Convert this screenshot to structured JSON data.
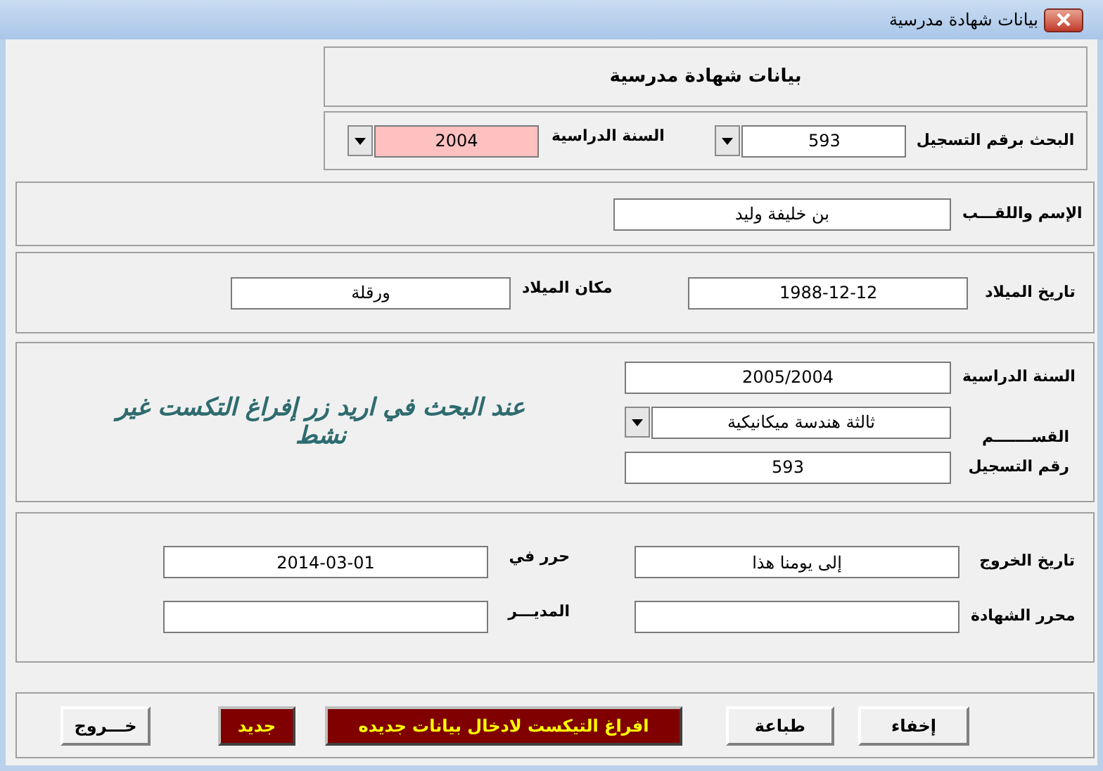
{
  "window": {
    "title": "بيانات شهادة مدرسية"
  },
  "header": {
    "title": "بيانات شهادة مدرسية"
  },
  "search": [
    {
      "label": "البحث برقم التسجيل",
      "value": "593",
      "highlighted": false
    },
    {
      "label": "السنة الدراسية",
      "value": "2004",
      "highlighted": true
    }
  ],
  "name_field": {
    "label": "الإسم واللقـــب",
    "value": "بن خليفة وليد"
  },
  "birth": [
    {
      "label": "تاريخ الميلاد",
      "value": "1988-12-12"
    },
    {
      "label": "مكان الميلاد",
      "value": "ورقلة"
    }
  ],
  "study": {
    "fields": [
      {
        "label": "السنة الدراسية",
        "value": "2005/2004",
        "kind": "text"
      },
      {
        "label": "القســـــــم",
        "value": "ثالثة هندسة ميكانيكية",
        "kind": "dropdown"
      },
      {
        "label": "رقم التسجيل",
        "value": "593",
        "kind": "text"
      }
    ],
    "note": "عند البحث في اريد زر إفراغ التكست غير نشط"
  },
  "exit": [
    {
      "label": "تاريخ الخروج",
      "value": "إلى يومنا هذا"
    },
    {
      "label": "محرر الشهادة"
    }
  ],
  "issue": [
    {
      "label": "حرر في",
      "value": "2014-03-01"
    },
    {
      "label": "المديـــر"
    }
  ],
  "buttons": [
    {
      "label": "إخفاء",
      "kind": "plain"
    },
    {
      "label": "طباعة",
      "kind": "plain"
    },
    {
      "label": "افراغ التيكست لادخال بيانات جديده",
      "kind": "accent"
    },
    {
      "label": "جديد",
      "kind": "accent"
    },
    {
      "label": "خـــروج",
      "kind": "plain"
    }
  ]
}
